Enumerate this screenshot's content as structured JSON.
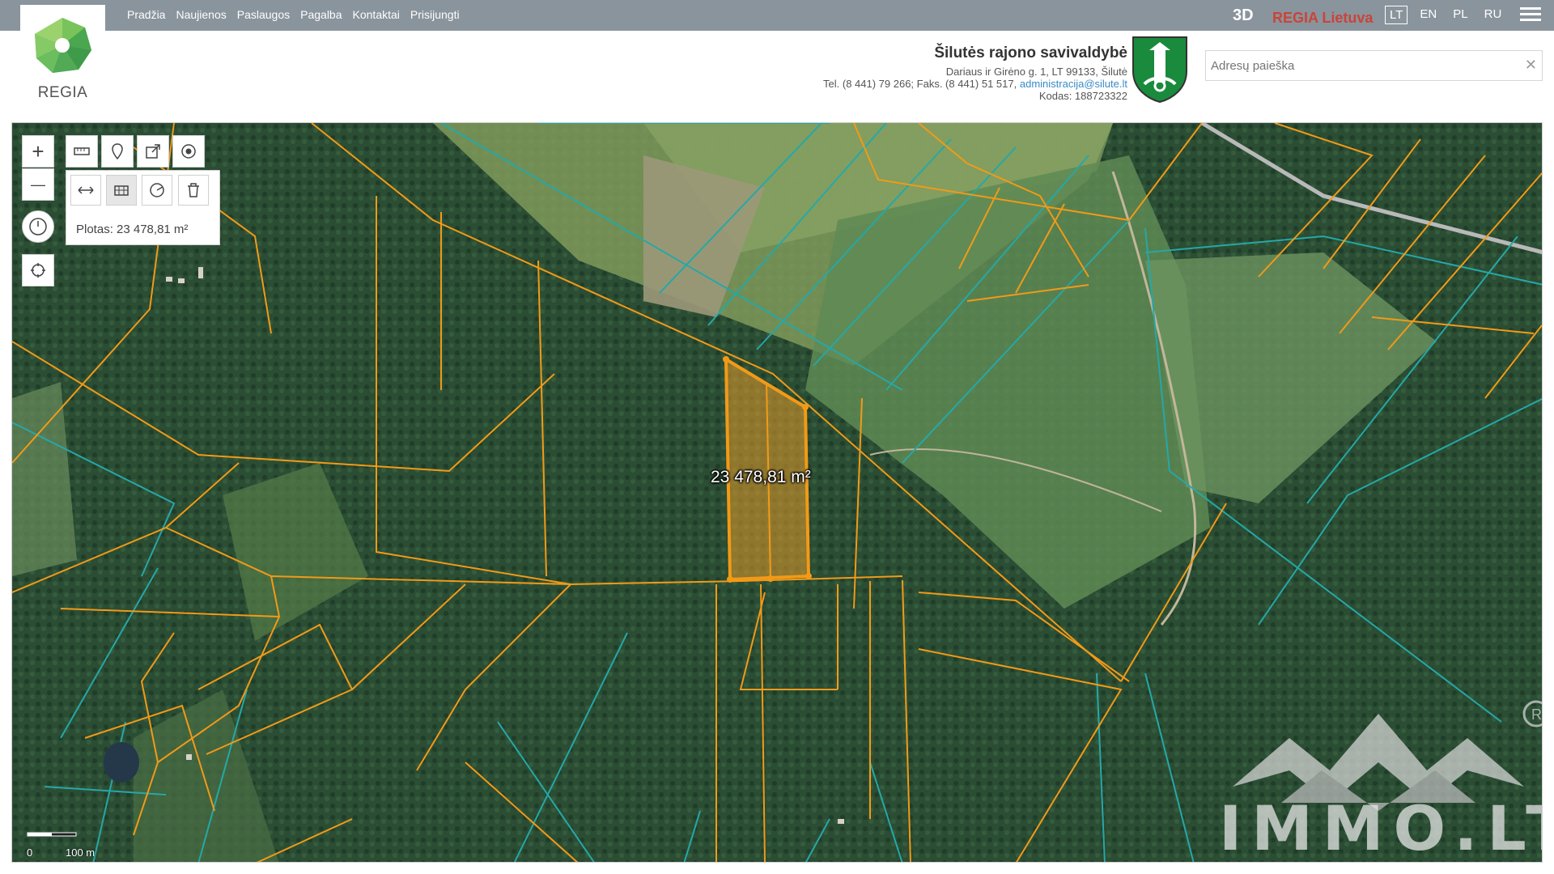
{
  "nav": {
    "links": [
      "Pradžia",
      "Naujienos",
      "Paslaugos",
      "Pagalba",
      "Kontaktai",
      "Prisijungti"
    ],
    "btn_3d": "3D",
    "regia_lt": "REGIA Lietuva",
    "langs": [
      "LT",
      "EN",
      "PL",
      "RU"
    ],
    "active_lang": "LT"
  },
  "logo": {
    "text": "REGIA"
  },
  "municipality": {
    "name": "Šilutės rajono savivaldybė",
    "address": "Dariaus ir Girėno g. 1, LT 99133, Šilutė",
    "phone": "Tel. (8 441) 79 266; Faks. (8 441) 51 517,",
    "email": "administracija@silute.lt",
    "code": "Kodas: 188723322"
  },
  "search": {
    "placeholder": "Adresų paieška",
    "value": "",
    "clear": "✕"
  },
  "map": {
    "measure_result": "Plotas: 23 478,81 m²",
    "area_label": "23 478,81 m²",
    "scale_start": "0",
    "scale_end": "100 m",
    "watermark": "IMMO.LT"
  },
  "tools": {
    "zoom_in": "+",
    "zoom_out": "—"
  },
  "colors": {
    "topbar": "#8a949c",
    "regia_red": "#c9443a",
    "parcel_orange": "#f29a17",
    "parcel_teal": "#25a8a8"
  }
}
